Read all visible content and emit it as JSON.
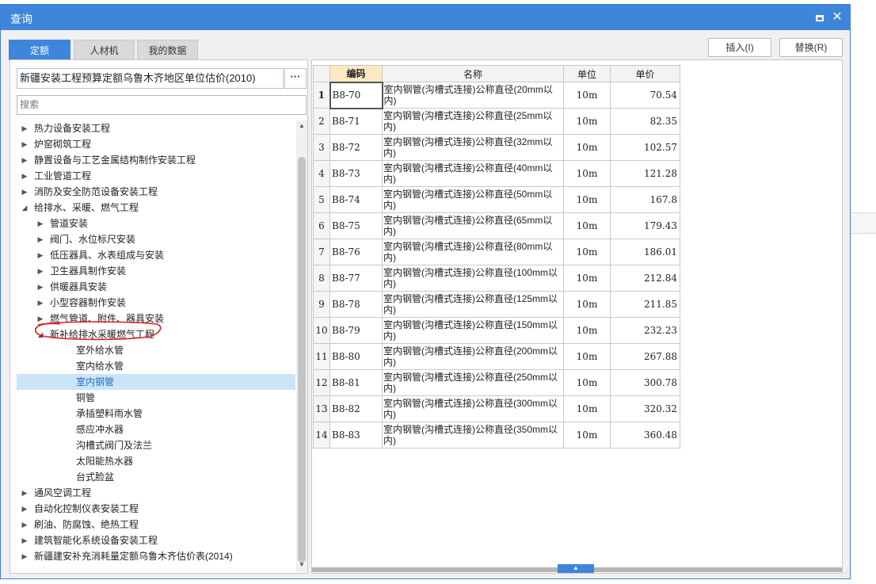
{
  "window": {
    "title": "查询",
    "maximize_icon": "maximize-icon",
    "close_icon": "close-icon",
    "accent_color": "#3d86dc"
  },
  "tabs": [
    {
      "label": "定额",
      "active": true
    },
    {
      "label": "人材机",
      "active": false
    },
    {
      "label": "我的数据",
      "active": false
    }
  ],
  "actions": {
    "insert_label": "插入(I)",
    "replace_label": "替换(R)"
  },
  "library": {
    "selected": "新疆安装工程预算定额乌鲁木齐地区单位估价(2010)",
    "more_label": "···"
  },
  "search": {
    "placeholder": "搜索"
  },
  "tree": [
    {
      "label": "热力设备安装工程",
      "level": 0,
      "expanded": false
    },
    {
      "label": "炉窑砌筑工程",
      "level": 0,
      "expanded": false
    },
    {
      "label": "静置设备与工艺金属结构制作安装工程",
      "level": 0,
      "expanded": false
    },
    {
      "label": "工业管道工程",
      "level": 0,
      "expanded": false
    },
    {
      "label": "消防及安全防范设备安装工程",
      "level": 0,
      "expanded": false
    },
    {
      "label": "给排水、采暖、燃气工程",
      "level": 0,
      "expanded": true
    },
    {
      "label": "管道安装",
      "level": 1,
      "expanded": false
    },
    {
      "label": "阀门、水位标尺安装",
      "level": 1,
      "expanded": false
    },
    {
      "label": "低压器具、水表组成与安装",
      "level": 1,
      "expanded": false
    },
    {
      "label": "卫生器具制作安装",
      "level": 1,
      "expanded": false
    },
    {
      "label": "供暖器具安装",
      "level": 1,
      "expanded": false
    },
    {
      "label": "小型容器制作安装",
      "level": 1,
      "expanded": false
    },
    {
      "label": "燃气管道、附件、器具安装",
      "level": 1,
      "expanded": false
    },
    {
      "label": "新补给排水采暖燃气工程",
      "level": 1,
      "expanded": true
    },
    {
      "label": "室外给水管",
      "level": 2,
      "leaf": true
    },
    {
      "label": "室内给水管",
      "level": 2,
      "leaf": true
    },
    {
      "label": "室内钢管",
      "level": 2,
      "leaf": true,
      "selected": true
    },
    {
      "label": "铜管",
      "level": 2,
      "leaf": true
    },
    {
      "label": "承插塑料雨水管",
      "level": 2,
      "leaf": true
    },
    {
      "label": "感应冲水器",
      "level": 2,
      "leaf": true
    },
    {
      "label": "沟槽式阀门及法兰",
      "level": 2,
      "leaf": true
    },
    {
      "label": "太阳能热水器",
      "level": 2,
      "leaf": true
    },
    {
      "label": "台式脸盆",
      "level": 2,
      "leaf": true
    },
    {
      "label": "通风空调工程",
      "level": 0,
      "expanded": false
    },
    {
      "label": "自动化控制仪表安装工程",
      "level": 0,
      "expanded": false
    },
    {
      "label": "刷油、防腐蚀、绝热工程",
      "level": 0,
      "expanded": false
    },
    {
      "label": "建筑智能化系统设备安装工程",
      "level": 0,
      "expanded": false
    },
    {
      "label": "新疆建安补充消耗量定额乌鲁木齐估价表(2014)",
      "level": 0,
      "expanded": false
    }
  ],
  "grid": {
    "columns": {
      "code": "编码",
      "name": "名称",
      "unit": "单位",
      "price": "单价"
    },
    "rows": [
      {
        "idx": "1",
        "code": "B8-70",
        "name": "室内钢管(沟槽式连接)公称直径(20mm以内)",
        "unit": "10m",
        "price": "70.54"
      },
      {
        "idx": "2",
        "code": "B8-71",
        "name": "室内钢管(沟槽式连接)公称直径(25mm以内)",
        "unit": "10m",
        "price": "82.35"
      },
      {
        "idx": "3",
        "code": "B8-72",
        "name": "室内钢管(沟槽式连接)公称直径(32mm以内)",
        "unit": "10m",
        "price": "102.57"
      },
      {
        "idx": "4",
        "code": "B8-73",
        "name": "室内钢管(沟槽式连接)公称直径(40mm以内)",
        "unit": "10m",
        "price": "121.28"
      },
      {
        "idx": "5",
        "code": "B8-74",
        "name": "室内钢管(沟槽式连接)公称直径(50mm以内)",
        "unit": "10m",
        "price": "167.8"
      },
      {
        "idx": "6",
        "code": "B8-75",
        "name": "室内钢管(沟槽式连接)公称直径(65mm以内)",
        "unit": "10m",
        "price": "179.43"
      },
      {
        "idx": "7",
        "code": "B8-76",
        "name": "室内钢管(沟槽式连接)公称直径(80mm以内)",
        "unit": "10m",
        "price": "186.01"
      },
      {
        "idx": "8",
        "code": "B8-77",
        "name": "室内钢管(沟槽式连接)公称直径(100mm以内)",
        "unit": "10m",
        "price": "212.84"
      },
      {
        "idx": "9",
        "code": "B8-78",
        "name": "室内钢管(沟槽式连接)公称直径(125mm以内)",
        "unit": "10m",
        "price": "211.85"
      },
      {
        "idx": "10",
        "code": "B8-79",
        "name": "室内钢管(沟槽式连接)公称直径(150mm以内)",
        "unit": "10m",
        "price": "232.23"
      },
      {
        "idx": "11",
        "code": "B8-80",
        "name": "室内钢管(沟槽式连接)公称直径(200mm以内)",
        "unit": "10m",
        "price": "267.88"
      },
      {
        "idx": "12",
        "code": "B8-81",
        "name": "室内钢管(沟槽式连接)公称直径(250mm以内)",
        "unit": "10m",
        "price": "300.78"
      },
      {
        "idx": "13",
        "code": "B8-82",
        "name": "室内钢管(沟槽式连接)公称直径(300mm以内)",
        "unit": "10m",
        "price": "320.32"
      },
      {
        "idx": "14",
        "code": "B8-83",
        "name": "室内钢管(沟槽式连接)公称直径(350mm以内)",
        "unit": "10m",
        "price": "360.48"
      }
    ]
  },
  "annotation": {
    "color": "#d9201f"
  }
}
